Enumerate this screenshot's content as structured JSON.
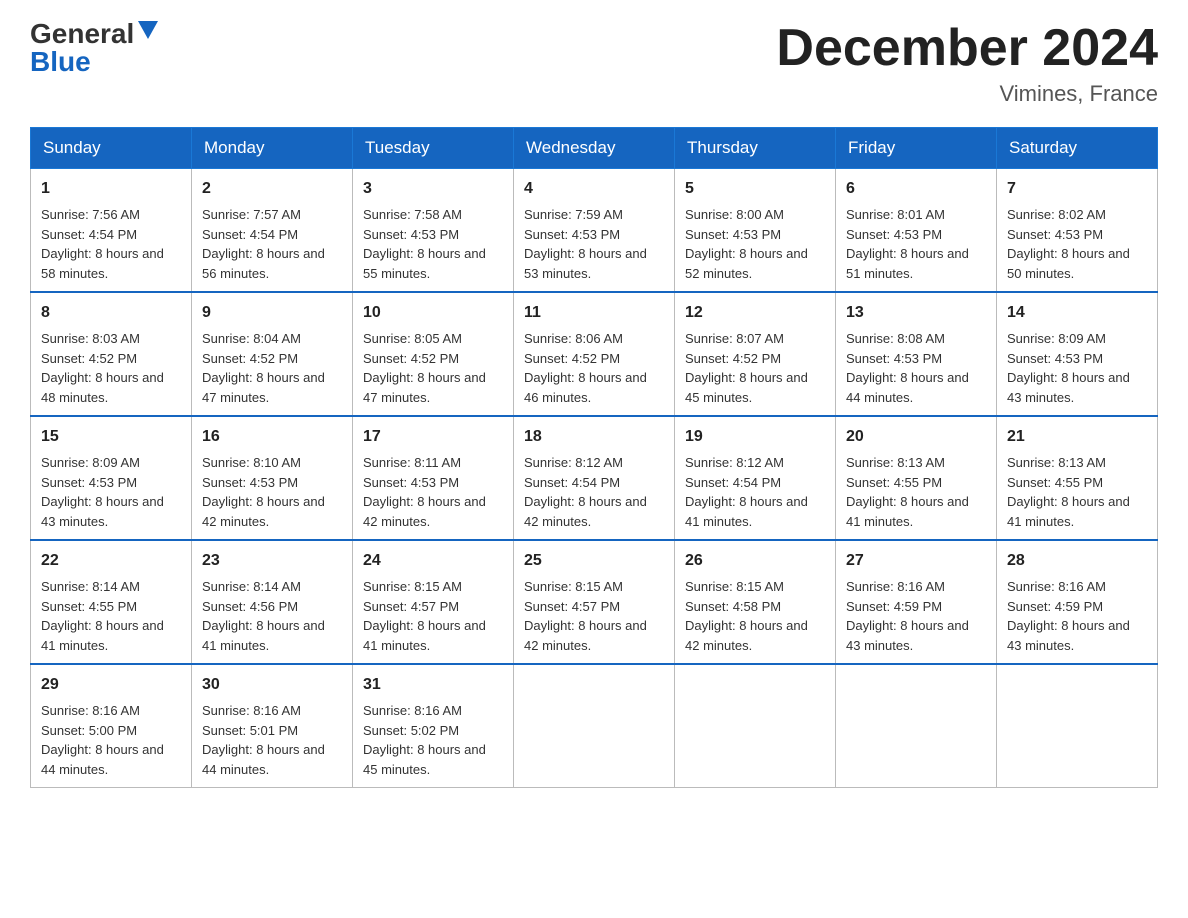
{
  "header": {
    "logo_general": "General",
    "logo_blue": "Blue",
    "month_title": "December 2024",
    "location": "Vimines, France"
  },
  "days_of_week": [
    "Sunday",
    "Monday",
    "Tuesday",
    "Wednesday",
    "Thursday",
    "Friday",
    "Saturday"
  ],
  "weeks": [
    [
      {
        "day": "1",
        "sunrise": "7:56 AM",
        "sunset": "4:54 PM",
        "daylight": "8 hours and 58 minutes."
      },
      {
        "day": "2",
        "sunrise": "7:57 AM",
        "sunset": "4:54 PM",
        "daylight": "8 hours and 56 minutes."
      },
      {
        "day": "3",
        "sunrise": "7:58 AM",
        "sunset": "4:53 PM",
        "daylight": "8 hours and 55 minutes."
      },
      {
        "day": "4",
        "sunrise": "7:59 AM",
        "sunset": "4:53 PM",
        "daylight": "8 hours and 53 minutes."
      },
      {
        "day": "5",
        "sunrise": "8:00 AM",
        "sunset": "4:53 PM",
        "daylight": "8 hours and 52 minutes."
      },
      {
        "day": "6",
        "sunrise": "8:01 AM",
        "sunset": "4:53 PM",
        "daylight": "8 hours and 51 minutes."
      },
      {
        "day": "7",
        "sunrise": "8:02 AM",
        "sunset": "4:53 PM",
        "daylight": "8 hours and 50 minutes."
      }
    ],
    [
      {
        "day": "8",
        "sunrise": "8:03 AM",
        "sunset": "4:52 PM",
        "daylight": "8 hours and 48 minutes."
      },
      {
        "day": "9",
        "sunrise": "8:04 AM",
        "sunset": "4:52 PM",
        "daylight": "8 hours and 47 minutes."
      },
      {
        "day": "10",
        "sunrise": "8:05 AM",
        "sunset": "4:52 PM",
        "daylight": "8 hours and 47 minutes."
      },
      {
        "day": "11",
        "sunrise": "8:06 AM",
        "sunset": "4:52 PM",
        "daylight": "8 hours and 46 minutes."
      },
      {
        "day": "12",
        "sunrise": "8:07 AM",
        "sunset": "4:52 PM",
        "daylight": "8 hours and 45 minutes."
      },
      {
        "day": "13",
        "sunrise": "8:08 AM",
        "sunset": "4:53 PM",
        "daylight": "8 hours and 44 minutes."
      },
      {
        "day": "14",
        "sunrise": "8:09 AM",
        "sunset": "4:53 PM",
        "daylight": "8 hours and 43 minutes."
      }
    ],
    [
      {
        "day": "15",
        "sunrise": "8:09 AM",
        "sunset": "4:53 PM",
        "daylight": "8 hours and 43 minutes."
      },
      {
        "day": "16",
        "sunrise": "8:10 AM",
        "sunset": "4:53 PM",
        "daylight": "8 hours and 42 minutes."
      },
      {
        "day": "17",
        "sunrise": "8:11 AM",
        "sunset": "4:53 PM",
        "daylight": "8 hours and 42 minutes."
      },
      {
        "day": "18",
        "sunrise": "8:12 AM",
        "sunset": "4:54 PM",
        "daylight": "8 hours and 42 minutes."
      },
      {
        "day": "19",
        "sunrise": "8:12 AM",
        "sunset": "4:54 PM",
        "daylight": "8 hours and 41 minutes."
      },
      {
        "day": "20",
        "sunrise": "8:13 AM",
        "sunset": "4:55 PM",
        "daylight": "8 hours and 41 minutes."
      },
      {
        "day": "21",
        "sunrise": "8:13 AM",
        "sunset": "4:55 PM",
        "daylight": "8 hours and 41 minutes."
      }
    ],
    [
      {
        "day": "22",
        "sunrise": "8:14 AM",
        "sunset": "4:55 PM",
        "daylight": "8 hours and 41 minutes."
      },
      {
        "day": "23",
        "sunrise": "8:14 AM",
        "sunset": "4:56 PM",
        "daylight": "8 hours and 41 minutes."
      },
      {
        "day": "24",
        "sunrise": "8:15 AM",
        "sunset": "4:57 PM",
        "daylight": "8 hours and 41 minutes."
      },
      {
        "day": "25",
        "sunrise": "8:15 AM",
        "sunset": "4:57 PM",
        "daylight": "8 hours and 42 minutes."
      },
      {
        "day": "26",
        "sunrise": "8:15 AM",
        "sunset": "4:58 PM",
        "daylight": "8 hours and 42 minutes."
      },
      {
        "day": "27",
        "sunrise": "8:16 AM",
        "sunset": "4:59 PM",
        "daylight": "8 hours and 43 minutes."
      },
      {
        "day": "28",
        "sunrise": "8:16 AM",
        "sunset": "4:59 PM",
        "daylight": "8 hours and 43 minutes."
      }
    ],
    [
      {
        "day": "29",
        "sunrise": "8:16 AM",
        "sunset": "5:00 PM",
        "daylight": "8 hours and 44 minutes."
      },
      {
        "day": "30",
        "sunrise": "8:16 AM",
        "sunset": "5:01 PM",
        "daylight": "8 hours and 44 minutes."
      },
      {
        "day": "31",
        "sunrise": "8:16 AM",
        "sunset": "5:02 PM",
        "daylight": "8 hours and 45 minutes."
      },
      null,
      null,
      null,
      null
    ]
  ]
}
